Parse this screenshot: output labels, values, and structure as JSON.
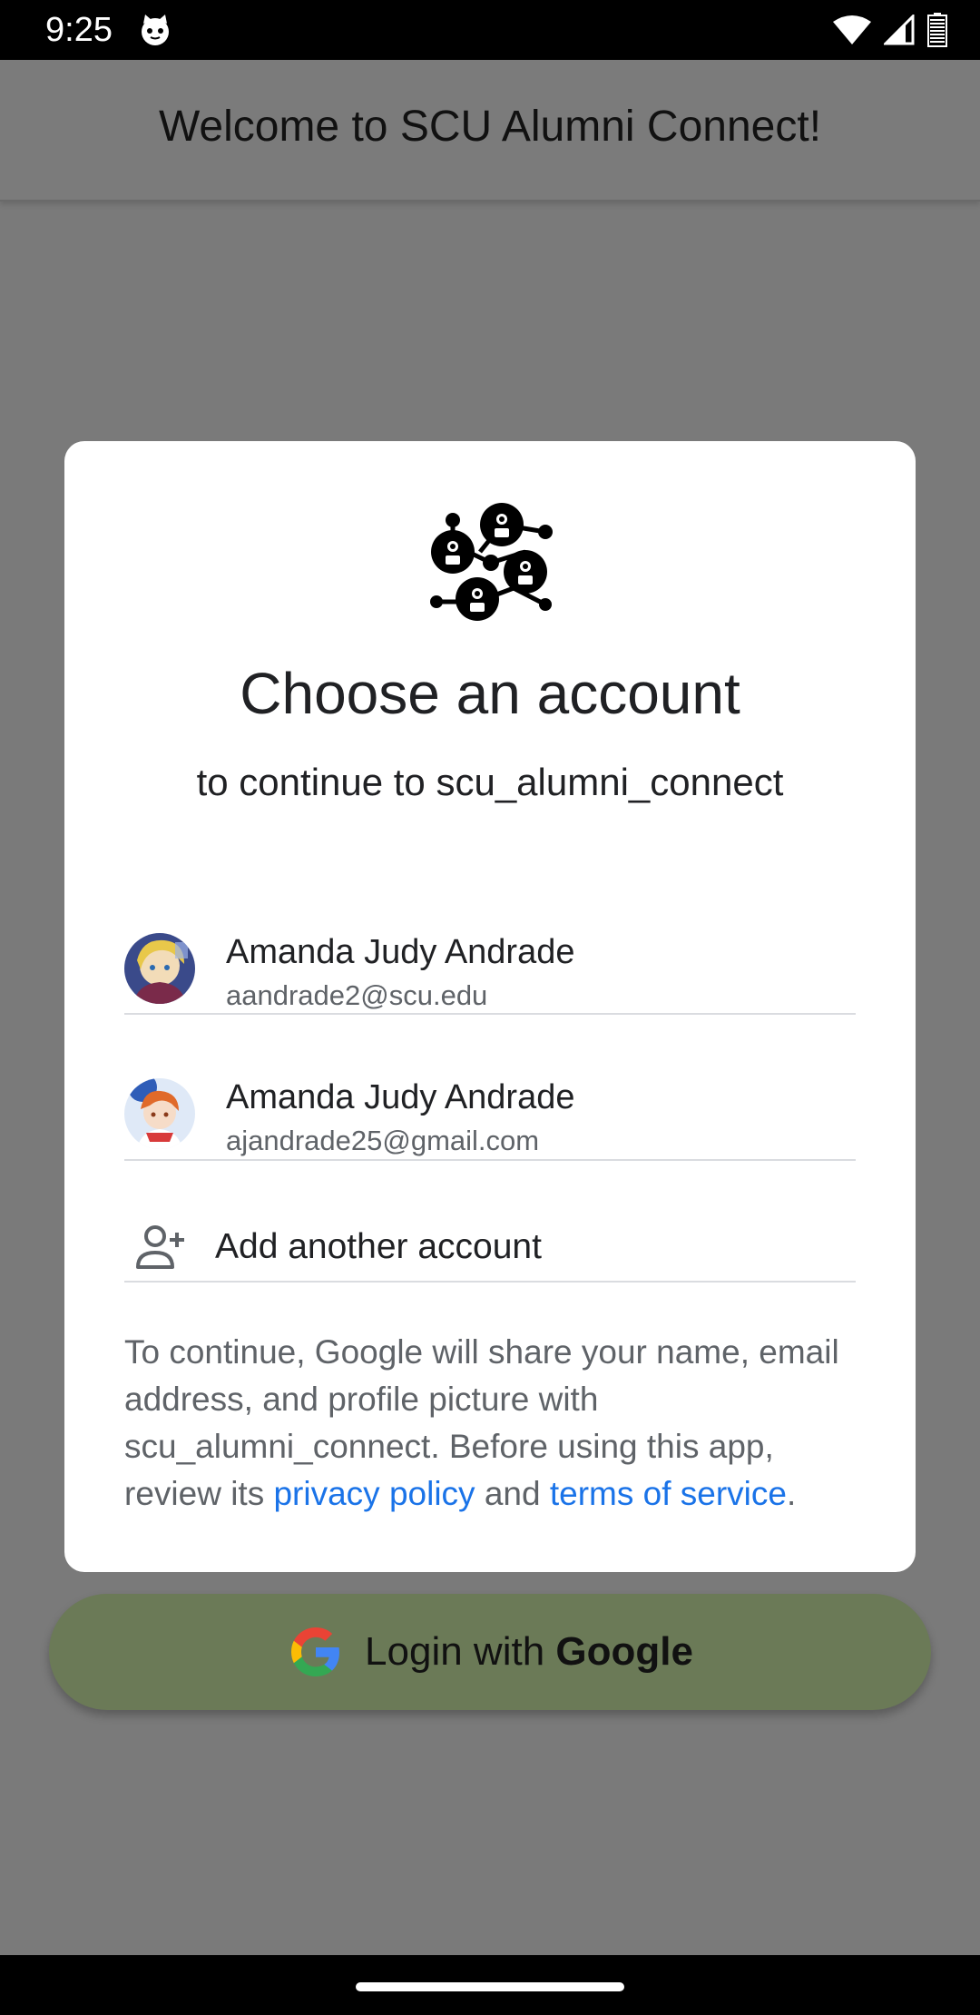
{
  "status_bar": {
    "time": "9:25",
    "icons": [
      "cat-notification-icon",
      "wifi-icon",
      "signal-icon",
      "battery-icon"
    ]
  },
  "app_bar": {
    "title": "Welcome to SCU Alumni Connect!"
  },
  "login_button": {
    "label_prefix": "Login with ",
    "label_bold": "Google",
    "icon": "google-g-icon",
    "color": "#6b7a57"
  },
  "dialog": {
    "logo": "network-people-icon",
    "title": "Choose an account",
    "subtitle": "to continue to scu_alumni_connect",
    "accounts": [
      {
        "name": "Amanda Judy Andrade",
        "email": "aandrade2@scu.edu",
        "avatar": "anime-avatar-1"
      },
      {
        "name": "Amanda Judy Andrade",
        "email": "ajandrade25@gmail.com",
        "avatar": "anime-avatar-2"
      }
    ],
    "add_account": {
      "label": "Add another account",
      "icon": "person-add-icon"
    },
    "disclaimer": {
      "text_1": "To continue, Google will share your name, email address, and profile picture with scu_alumni_connect. Before using this app, review its ",
      "privacy_link": "privacy policy",
      "text_2": " and ",
      "terms_link": "terms of service",
      "text_3": "."
    },
    "link_color": "#1a73e8"
  }
}
